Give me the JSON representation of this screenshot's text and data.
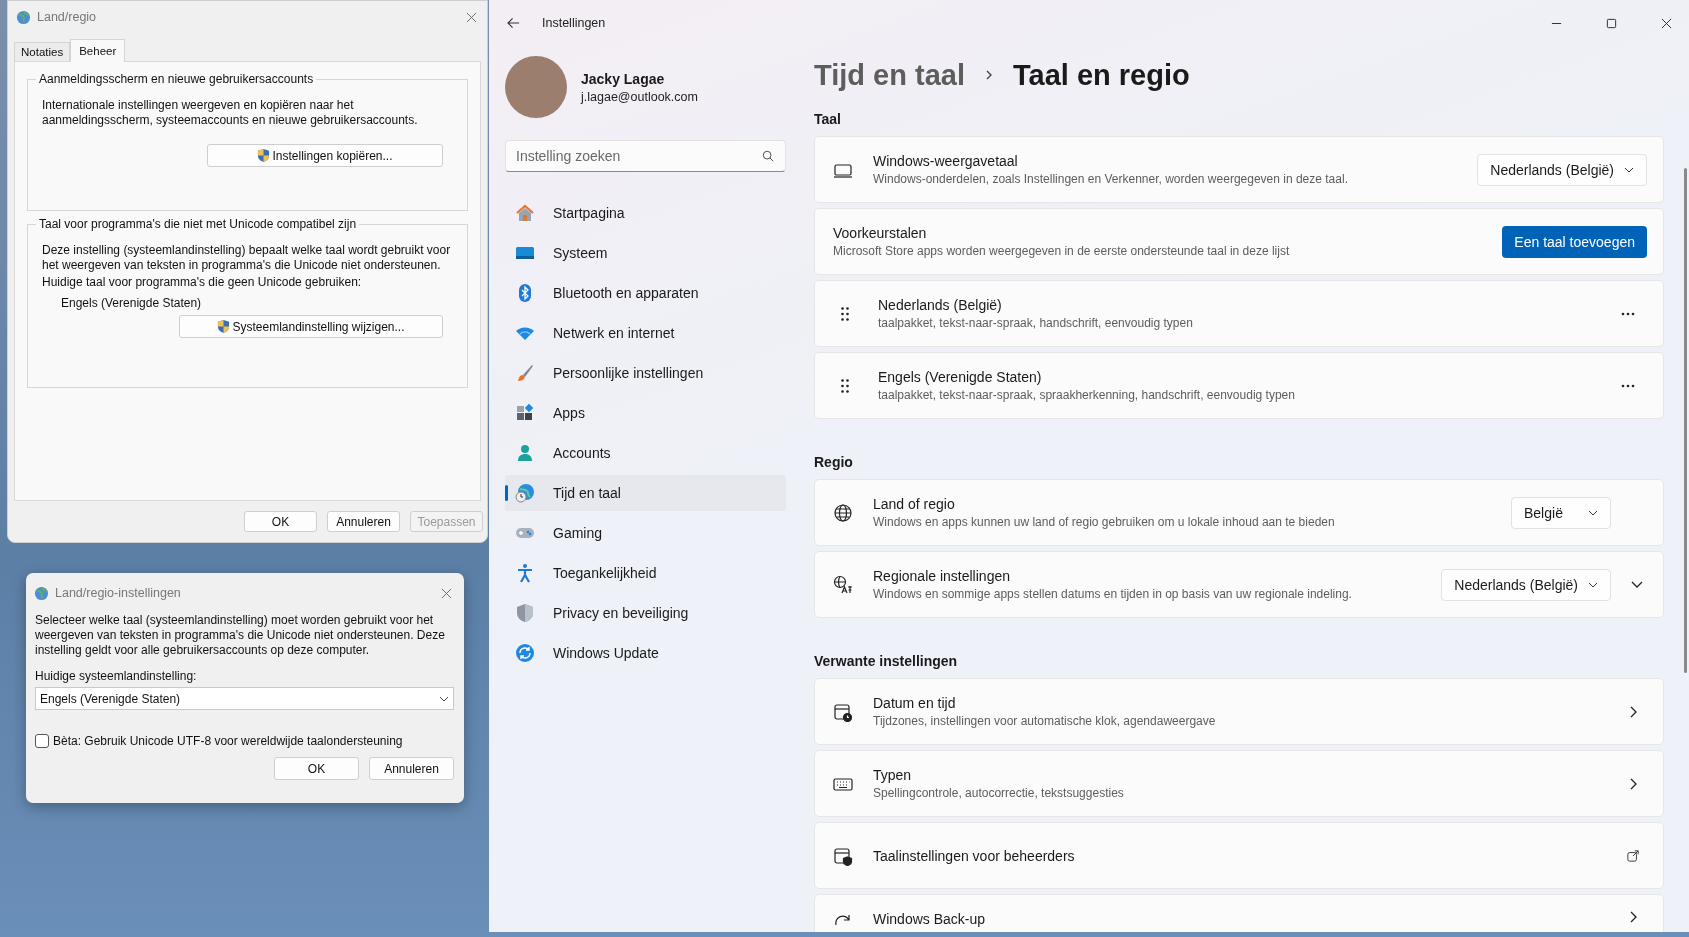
{
  "land_regio_dialog": {
    "title": "Land/regio",
    "tabs": [
      {
        "label": "Notaties",
        "selected": false
      },
      {
        "label": "Beheer",
        "selected": true
      }
    ],
    "login_group": {
      "heading": "Aanmeldingsscherm en nieuwe gebruikersaccounts",
      "text": "Internationale instellingen weergeven en kopiëren naar het aanmeldingsscherm, systeemaccounts en nieuwe gebruikersaccounts.",
      "button": "Instellingen kopiëren..."
    },
    "unicode_group": {
      "heading": "Taal voor programma's die niet met Unicode compatibel zijn",
      "text": "Deze instelling (systeemlandinstelling) bepaalt welke taal wordt gebruikt voor het weergeven van teksten in programma's die Unicode niet ondersteunen.",
      "label": "Huidige taal voor programma's die geen Unicode gebruiken:",
      "value": "Engels (Verenigde Staten)",
      "button": "Systeemlandinstelling wijzigen..."
    },
    "buttons": [
      {
        "label": "OK",
        "disabled": false
      },
      {
        "label": "Annuleren",
        "disabled": false
      },
      {
        "label": "Toepassen",
        "disabled": true
      }
    ]
  },
  "locale_dialog": {
    "title": "Land/regio-instellingen",
    "description": "Selecteer welke taal (systeemlandinstelling) moet worden gebruikt voor het weergeven van teksten in programma's die Unicode niet ondersteunen. Deze instelling geldt voor alle gebruikersaccounts op deze computer.",
    "field_label": "Huidige systeemlandinstelling:",
    "dropdown_value": "Engels (Verenigde Staten)",
    "checkbox": {
      "label": "Bèta: Gebruik Unicode UTF-8 voor wereldwijde taalondersteuning",
      "checked": false
    },
    "buttons": [
      "OK",
      "Annuleren"
    ]
  },
  "settings": {
    "title": "Instellingen",
    "user": {
      "name": "Jacky Lagae",
      "email": "j.lagae@outlook.com"
    },
    "search": {
      "placeholder": "Instelling zoeken"
    },
    "nav": [
      {
        "label": "Startpagina",
        "selected": false
      },
      {
        "label": "Systeem",
        "selected": false
      },
      {
        "label": "Bluetooth en apparaten",
        "selected": false
      },
      {
        "label": "Netwerk en internet",
        "selected": false
      },
      {
        "label": "Persoonlijke instellingen",
        "selected": false
      },
      {
        "label": "Apps",
        "selected": false
      },
      {
        "label": "Accounts",
        "selected": false
      },
      {
        "label": "Tijd en taal",
        "selected": true
      },
      {
        "label": "Gaming",
        "selected": false
      },
      {
        "label": "Toegankelijkheid",
        "selected": false
      },
      {
        "label": "Privacy en beveiliging",
        "selected": false
      },
      {
        "label": "Windows Update",
        "selected": false
      }
    ],
    "breadcrumb": {
      "parent": "Tijd en taal",
      "current": "Taal en regio"
    },
    "sections": [
      {
        "heading": "Taal",
        "rows": [
          {
            "kind": "dropdown",
            "title": "Windows-weergavetaal",
            "description": "Windows-onderdelen, zoals Instellingen en Verkenner, worden weergegeven in deze taal.",
            "value": "Nederlands (België)"
          },
          {
            "kind": "button",
            "title": "Voorkeurstalen",
            "description": "Microsoft Store apps worden weergegeven in de eerste ondersteunde taal in deze lijst",
            "button": "Een taal toevoegen"
          },
          {
            "kind": "language",
            "title": "Nederlands (België)",
            "description": "taalpakket, tekst-naar-spraak, handschrift, eenvoudig typen"
          },
          {
            "kind": "language",
            "title": "Engels (Verenigde Staten)",
            "description": "taalpakket, tekst-naar-spraak, spraakherkenning, handschrift, eenvoudig typen"
          }
        ]
      },
      {
        "heading": "Regio",
        "rows": [
          {
            "kind": "dropdown",
            "title": "Land of regio",
            "description": "Windows en apps kunnen uw land of regio gebruiken om u lokale inhoud aan te bieden",
            "value": "België"
          },
          {
            "kind": "dropdown-expand",
            "title": "Regionale instellingen",
            "description": "Windows en sommige apps stellen datums en tijden in op basis van uw regionale indeling.",
            "value": "Nederlands (België)"
          }
        ]
      },
      {
        "heading": "Verwante instellingen",
        "rows": [
          {
            "kind": "link",
            "title": "Datum en tijd",
            "description": "Tijdzones, instellingen voor automatische klok, agendaweergave"
          },
          {
            "kind": "link",
            "title": "Typen",
            "description": "Spellingcontrole, autocorrectie, tekstsuggesties"
          },
          {
            "kind": "external",
            "title": "Taalinstellingen voor beheerders"
          },
          {
            "kind": "link",
            "title": "Windows Back-up"
          }
        ]
      }
    ]
  }
}
